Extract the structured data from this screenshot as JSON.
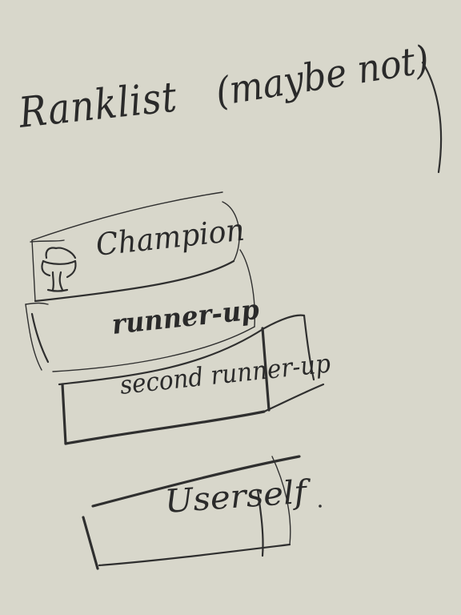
{
  "page": {
    "title": "Ranklist",
    "subtitle": "(maybe not)"
  },
  "ranklist": {
    "items": [
      {
        "label": "Champion",
        "icon": "trophy-icon"
      },
      {
        "label": "runner-up"
      },
      {
        "label": "second runner-up"
      },
      {
        "label": "Userself"
      }
    ]
  },
  "colors": {
    "background": "#d8d7cb",
    "ink": "#2f2f2f"
  }
}
